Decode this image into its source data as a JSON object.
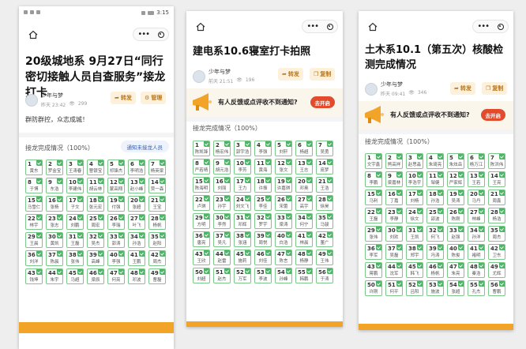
{
  "phone": {
    "time": "3:15"
  },
  "panels": [
    {
      "title": "20级城地系 9月27日“同行密切接触人员自查服务”接龙打卡",
      "author": "少年与梦",
      "time": "昨天 23:42",
      "views": "299",
      "buttons": [
        {
          "label": "转发",
          "icon": "share-arrow-icon"
        },
        {
          "label": "管理",
          "icon": "gear-icon"
        }
      ],
      "body": "群防群控，众志成城！",
      "section": "接龙完成情况（100%）",
      "notify": "通知未接龙人员",
      "cells": [
        [
          "1",
          "黄东"
        ],
        [
          "2",
          "罗金宝"
        ],
        [
          "3",
          "王涛春"
        ],
        [
          "4",
          "曹银宝"
        ],
        [
          "5",
          "祁锋杰"
        ],
        [
          "6",
          "李明浩"
        ],
        [
          "7",
          "杨英梁"
        ],
        [
          "8",
          "于博"
        ],
        [
          "9",
          "东浩"
        ],
        [
          "10",
          "李建伟"
        ],
        [
          "11",
          "胡云林"
        ],
        [
          "12",
          "蒙高翔"
        ],
        [
          "13",
          "赵小峰"
        ],
        [
          "14",
          "贾一森"
        ],
        [
          "15",
          "马雪仁"
        ],
        [
          "16",
          "张杨"
        ],
        [
          "17",
          "子文"
        ],
        [
          "18",
          "张元宏"
        ],
        [
          "19",
          "付强"
        ],
        [
          "20",
          "张超"
        ],
        [
          "21",
          "王宝"
        ],
        [
          "22",
          "林宇"
        ],
        [
          "23",
          "张志"
        ],
        [
          "24",
          "刘鹏"
        ],
        [
          "25",
          "周宏"
        ],
        [
          "26",
          "李瑞"
        ],
        [
          "27",
          "叶飞"
        ],
        [
          "28",
          "杨帆"
        ],
        [
          "29",
          "王晨"
        ],
        [
          "30",
          "黄凯"
        ],
        [
          "31",
          "王磊"
        ],
        [
          "32",
          "吴杰"
        ],
        [
          "33",
          "郭涛"
        ],
        [
          "34",
          "孙浩"
        ],
        [
          "35",
          "赵阳"
        ],
        [
          "36",
          "刘洋"
        ],
        [
          "37",
          "陈晨"
        ],
        [
          "38",
          "张伟"
        ],
        [
          "39",
          "高峰"
        ],
        [
          "40",
          "李强"
        ],
        [
          "41",
          "王鹏"
        ],
        [
          "42",
          "周杰"
        ],
        [
          "43",
          "钱坤"
        ],
        [
          "44",
          "朱宇"
        ],
        [
          "45",
          "马超"
        ],
        [
          "46",
          "梁辰"
        ],
        [
          "47",
          "何亮"
        ],
        [
          "48",
          "邓波"
        ],
        [
          "49",
          "曹磊"
        ]
      ]
    },
    {
      "title": "建电系10.6寝室打卡拍照",
      "author": "少年与梦",
      "time": "前天 21:51",
      "views": "196",
      "buttons": [
        {
          "label": "转发",
          "icon": "share-arrow-icon"
        },
        {
          "label": "复制",
          "icon": "copy-icon"
        }
      ],
      "banner": {
        "text": "有人反馈或点评收不到通知?",
        "action": "去开启"
      },
      "section": "接龙完成情况（100%）",
      "cells": [
        [
          "1",
          "陈凯锋"
        ],
        [
          "2",
          "杨宏伟"
        ],
        [
          "3",
          "郭宇浩"
        ],
        [
          "4",
          "李强"
        ],
        [
          "5",
          "刘轩"
        ],
        [
          "6",
          "杨超"
        ],
        [
          "7",
          "吴勇"
        ],
        [
          "8",
          "严若晴"
        ],
        [
          "9",
          "胡元浩"
        ],
        [
          "10",
          "李芳"
        ],
        [
          "11",
          "黄海"
        ],
        [
          "12",
          "张文"
        ],
        [
          "13",
          "王志"
        ],
        [
          "14",
          "庞梦"
        ],
        [
          "15",
          "陈海明"
        ],
        [
          "16",
          "刘丽"
        ],
        [
          "17",
          "王力"
        ],
        [
          "18",
          "许振"
        ],
        [
          "19",
          "许嘉琪"
        ],
        [
          "20",
          "邓奥"
        ],
        [
          "21",
          "王浩"
        ],
        [
          "22",
          "卢琪"
        ],
        [
          "23",
          "孙宇"
        ],
        [
          "24",
          "刘文飞"
        ],
        [
          "25",
          "李佳"
        ],
        [
          "26",
          "宋蕾"
        ],
        [
          "27",
          "高宇"
        ],
        [
          "28",
          "徐昊"
        ],
        [
          "29",
          "方明"
        ],
        [
          "30",
          "李然"
        ],
        [
          "31",
          "邓辉"
        ],
        [
          "32",
          "罗宇"
        ],
        [
          "33",
          "梁涛"
        ],
        [
          "34",
          "何宁"
        ],
        [
          "35",
          "马骏"
        ],
        [
          "36",
          "唐亮"
        ],
        [
          "37",
          "吴凡"
        ],
        [
          "38",
          "张涵"
        ],
        [
          "39",
          "周悦"
        ],
        [
          "40",
          "白浩"
        ],
        [
          "41",
          "林晨"
        ],
        [
          "42",
          "董广"
        ],
        [
          "43",
          "王欣"
        ],
        [
          "44",
          "赵雷"
        ],
        [
          "45",
          "施莉"
        ],
        [
          "46",
          "刘佳"
        ],
        [
          "47",
          "陈言"
        ],
        [
          "48",
          "杨静"
        ],
        [
          "49",
          "王伟"
        ],
        [
          "50",
          "刘超"
        ],
        [
          "51",
          "赵杰"
        ],
        [
          "52",
          "万军"
        ],
        [
          "53",
          "李波"
        ],
        [
          "54",
          "孙峰"
        ],
        [
          "55",
          "韩鹏"
        ],
        [
          "56",
          "于涛"
        ]
      ]
    },
    {
      "title": "土木系10.1（第五次）核酸检测完成情况",
      "author": "少年与梦",
      "time": "昨天 09:41",
      "views": "346",
      "buttons": [
        {
          "label": "转发",
          "icon": "share-arrow-icon"
        },
        {
          "label": "复制",
          "icon": "copy-icon"
        }
      ],
      "banner": {
        "text": "有人反馈或点评收不到通知?",
        "action": "去开启"
      },
      "section": "接龙完成情况（100%）",
      "cells": [
        [
          "1",
          "文宇鑫"
        ],
        [
          "2",
          "熊高祥"
        ],
        [
          "3",
          "赵思淼"
        ],
        [
          "4",
          "朱琦亮"
        ],
        [
          "5",
          "朱炫岳"
        ],
        [
          "6",
          "杨万江"
        ],
        [
          "7",
          "陈洪伟"
        ],
        [
          "8",
          "李鹏"
        ],
        [
          "9",
          "梁嘉林"
        ],
        [
          "10",
          "李浩宇"
        ],
        [
          "11",
          "邹健"
        ],
        [
          "12",
          "严家辉"
        ],
        [
          "13",
          "王若"
        ],
        [
          "14",
          "王亮"
        ],
        [
          "15",
          "马利"
        ],
        [
          "16",
          "丁嘉"
        ],
        [
          "17",
          "刘杨"
        ],
        [
          "18",
          "孙浩"
        ],
        [
          "19",
          "吴涛"
        ],
        [
          "20",
          "马丹"
        ],
        [
          "21",
          "周鑫"
        ],
        [
          "22",
          "王磊"
        ],
        [
          "23",
          "李静"
        ],
        [
          "24",
          "徐文"
        ],
        [
          "25",
          "邵波"
        ],
        [
          "26",
          "陈刚"
        ],
        [
          "27",
          "林峰"
        ],
        [
          "28",
          "杨浩"
        ],
        [
          "29",
          "张伟"
        ],
        [
          "30",
          "刘欢"
        ],
        [
          "31",
          "王凯"
        ],
        [
          "32",
          "何飞"
        ],
        [
          "33",
          "赵强"
        ],
        [
          "34",
          "孙洋"
        ],
        [
          "35",
          "周杰"
        ],
        [
          "36",
          "李军"
        ],
        [
          "37",
          "吴磊"
        ],
        [
          "38",
          "郑宇"
        ],
        [
          "39",
          "冯涛"
        ],
        [
          "40",
          "陈俊"
        ],
        [
          "41",
          "褚明"
        ],
        [
          "42",
          "卫东"
        ],
        [
          "43",
          "蒋鹏"
        ],
        [
          "44",
          "沈军"
        ],
        [
          "45",
          "韩飞"
        ],
        [
          "46",
          "杨帆"
        ],
        [
          "47",
          "朱亮"
        ],
        [
          "48",
          "秦浩"
        ],
        [
          "49",
          "尤辉"
        ],
        [
          "50",
          "许刚"
        ],
        [
          "51",
          "何平"
        ],
        [
          "52",
          "吕阳"
        ],
        [
          "53",
          "施波"
        ],
        [
          "54",
          "张超"
        ],
        [
          "55",
          "孔杰"
        ],
        [
          "56",
          "曹鹏"
        ]
      ]
    }
  ]
}
